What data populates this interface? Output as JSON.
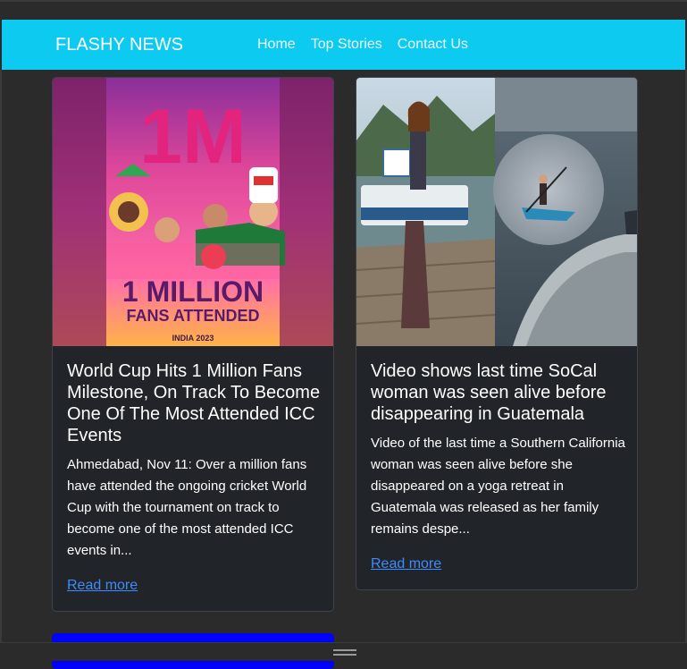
{
  "navbar": {
    "brand": "FLASHY NEWS",
    "links": [
      "Home",
      "Top Stories",
      "Contact Us"
    ],
    "background": "#0dcaf0"
  },
  "cards": [
    {
      "image_badge": "1M",
      "image_caption_line1": "1 MILLION",
      "image_caption_line2": "FANS ATTENDED",
      "image_logo": "INDIA 2023",
      "title": "World Cup Hits 1 Million Fans Milestone, On Track To Become One Of The Most Attended ICC Events",
      "text": "Ahmedabad, Nov 11: Over a million fans have attended the ongoing cricket World Cup with the tournament on track to become one of the most attended ICC events in...",
      "link": "Read more"
    },
    {
      "title": "Video shows last time SoCal woman was seen alive before disappearing in Guatemala",
      "text": "Video of the last time a Southern California woman was seen alive before she disappeared on a yoga retreat in Guatemala was released as her family remains despe...",
      "link": "Read more"
    }
  ],
  "colors": {
    "card_background": "#212529",
    "link": "#3d8bfd",
    "partial_card": "#0000ff"
  }
}
